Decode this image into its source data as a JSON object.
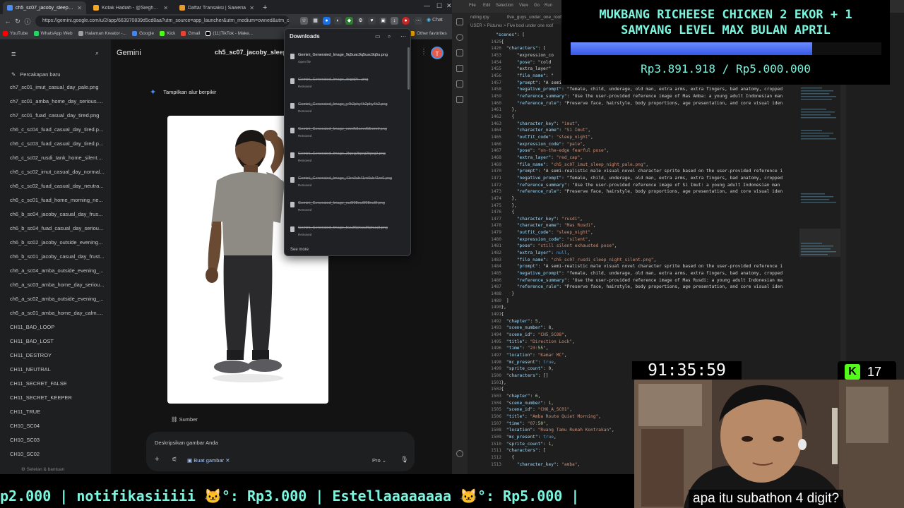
{
  "browser": {
    "tabs": [
      {
        "label": "ch5_sc07_jacoby_sleep_night_frustrat...",
        "active": true,
        "color": "#4c8df6"
      },
      {
        "label": "Kotak Hadiah - @Sieghart | Tako",
        "active": false,
        "color": "#f5a623"
      },
      {
        "label": "Daftar Transaksi | Saweria",
        "active": false,
        "color": "#f5a623"
      }
    ],
    "url": "https://gemini.google.com/u/2/app/663970839d5cd8aa?utm_source=app_launcher&utm_medium=owned&utm_ca...",
    "bookmarks": [
      "YouTube",
      "WhatsApp Web",
      "Halaman Kreator -...",
      "Google",
      "Kick",
      "Gmail",
      "(11)TikTok - Make...",
      "Other favorites"
    ],
    "chat_label": "Chat"
  },
  "gemini": {
    "brand": "Gemini",
    "title": "ch5_sc07_jacoby_sleep_n...",
    "avatar_letter": "T",
    "new_chat": "Percakapan baru",
    "sidebar_items": [
      "ch7_sc01_imut_casual_day_pale.png",
      "ch7_sc01_amba_home_day_serious.p...",
      "ch7_sc01_fuad_casual_day_tired.png",
      "ch6_c_sc04_fuad_casual_day_tired.p...",
      "ch6_c_sc03_fuad_casual_day_tired.p...",
      "ch6_c_sc02_rusdi_tank_home_silent....",
      "ch6_c_sc02_imut_casual_day_normal...",
      "ch6_c_sc02_fuad_casual_day_neutra...",
      "ch6_c_sc01_fuad_home_morning_ne...",
      "ch6_b_sc04_jacoby_casual_day_frus...",
      "ch6_b_sc04_fuad_casual_day_seriou...",
      "ch6_b_sc02_jacoby_outside_evening...",
      "ch6_b_sc01_jacoby_casual_day_frust...",
      "ch6_a_sc04_amba_outside_evening_...",
      "ch6_a_sc03_amba_home_day_seriou...",
      "ch6_a_sc02_amba_outside_evening_...",
      "ch6_a_sc01_amba_home_day_calm.p...",
      "CH11_BAD_LOOP",
      "CH11_BAD_LOST",
      "CH11_DESTROY",
      "CH11_NEUTRAL",
      "CH11_SECRET_FALSE",
      "CH11_SECRET_KEEPER",
      "CH11_TRUE",
      "CH10_SC04",
      "CH10_SC03",
      "CH10_SC02"
    ],
    "settings": "Setelan & bantuan",
    "thinking": "Tampilkan alur berpikir",
    "source": "Sumber",
    "prompt_placeholder": "Deskripsikan gambar Anda",
    "create_image": "Buat gambar",
    "model": "Pro"
  },
  "downloads": {
    "title": "Downloads",
    "items": [
      {
        "name": "Gemini_Generated_Image_9q5uac9q5uac9q5u.png",
        "status": "Open file",
        "removed": false
      },
      {
        "name": "Gemini_Generated_Image_dsgq9k...png",
        "status": "Removed",
        "removed": true
      },
      {
        "name": "Gemini_Generated_Image_y4h2phy4h2phy4h2.png",
        "status": "Removed",
        "removed": true
      },
      {
        "name": "Gemini_Generated_Image_xmnfk5xmnfk5xmnf.png",
        "status": "Removed",
        "removed": true
      },
      {
        "name": "Gemini_Generated_Image_2bprg2bprg2bprg2.png",
        "status": "Removed",
        "removed": true
      },
      {
        "name": "Gemini_Generated_Image_41rn0ub41rn0ub41rn0.png",
        "status": "Removed",
        "removed": true
      },
      {
        "name": "Gemini_Generated_Image_nu6f08nu6f08nu6f.png",
        "status": "Removed",
        "removed": true
      },
      {
        "name": "Gemini_Generated_Image_buu36pkuu36pkuu3.png",
        "status": "Removed",
        "removed": true
      }
    ],
    "see_more": "See more"
  },
  "editor": {
    "menus": [
      "File",
      "Edit",
      "Selection",
      "View",
      "Go",
      "Run"
    ],
    "tabs": [
      "nding.rpy",
      "five_guys_under_one_roof"
    ],
    "breadcrumb": "USER > Pictures > Five bool under one roof",
    "lines": [
      {
        "n": "",
        "t": "\"scenes\": ["
      },
      {
        "n": "1425",
        "t": "  {"
      },
      {
        "n": "1426",
        "t": "    \"characters\": ["
      },
      {
        "n": "1453",
        "t": "        \"expression_co"
      },
      {
        "n": "1454",
        "t": "        \"pose\": \"cold"
      },
      {
        "n": "1455",
        "t": "        \"extra_layer\""
      },
      {
        "n": "1456",
        "t": "        \"file_name\": \""
      },
      {
        "n": "1457",
        "t": "        \"prompt\": \"A semi-realistic male visual novel character sprite based on the user-provided reference i"
      },
      {
        "n": "1458",
        "t": "        \"negative_prompt\": \"female, child, underage, old man, extra arms, extra fingers, bad anatomy, cropped"
      },
      {
        "n": "1459",
        "t": "        \"reference_summary\": \"Use the user-provided reference image of Mas Amba: a young adult Indonesian man"
      },
      {
        "n": "1460",
        "t": "        \"reference_rule\": \"Preserve face, hairstyle, body proportions, age presentation, and core visual iden"
      },
      {
        "n": "1461",
        "t": "      },"
      },
      {
        "n": "1462",
        "t": "      {"
      },
      {
        "n": "1463",
        "t": "        \"character_key\": \"imut\","
      },
      {
        "n": "1464",
        "t": "        \"character_name\": \"Si Imut\","
      },
      {
        "n": "1465",
        "t": "        \"outfit_code\": \"sleep_night\","
      },
      {
        "n": "1466",
        "t": "        \"expression_code\": \"pale\","
      },
      {
        "n": "1467",
        "t": "        \"pose\": \"on-the-edge fearful pose\","
      },
      {
        "n": "1468",
        "t": "        \"extra_layer\": \"red_cap\","
      },
      {
        "n": "1469",
        "t": "        \"file_name\": \"ch5_sc07_imut_sleep_night_pale.png\","
      },
      {
        "n": "1470",
        "t": "        \"prompt\": \"A semi-realistic male visual novel character sprite based on the user-provided reference i"
      },
      {
        "n": "1471",
        "t": "        \"negative_prompt\": \"female, child, underage, old man, extra arms, extra fingers, bad anatomy, cropped"
      },
      {
        "n": "1472",
        "t": "        \"reference_summary\": \"Use the user-provided reference image of Si Imut: a young adult Indonesian man"
      },
      {
        "n": "1473",
        "t": "        \"reference_rule\": \"Preserve face, hairstyle, body proportions, age presentation, and core visual iden"
      },
      {
        "n": "1474",
        "t": "      },"
      },
      {
        "n": "1475",
        "t": "      },"
      },
      {
        "n": "1476",
        "t": "      {"
      },
      {
        "n": "1477",
        "t": "        \"character_key\": \"rusdi\","
      },
      {
        "n": "1478",
        "t": "        \"character_name\": \"Mas Rusdi\","
      },
      {
        "n": "1479",
        "t": "        \"outfit_code\": \"sleep_night\","
      },
      {
        "n": "1480",
        "t": "        \"expression_code\": \"silent\","
      },
      {
        "n": "1481",
        "t": "        \"pose\": \"still silent exhausted pose\","
      },
      {
        "n": "1482",
        "t": "        \"extra_layer\": null,"
      },
      {
        "n": "1483",
        "t": "        \"file_name\": \"ch5_sc07_rusdi_sleep_night_silent.png\","
      },
      {
        "n": "1484",
        "t": "        \"prompt\": \"A semi-realistic male visual novel character sprite based on the user-provided reference i"
      },
      {
        "n": "1485",
        "t": "        \"negative_prompt\": \"female, child, underage, old man, extra arms, extra fingers, bad anatomy, cropped"
      },
      {
        "n": "1486",
        "t": "        \"reference_summary\": \"Use the user-provided reference image of Mas Rusdi: a young adult Indonesian ma"
      },
      {
        "n": "1487",
        "t": "        \"reference_rule\": \"Preserve face, hairstyle, body proportions, age presentation, and core visual iden"
      },
      {
        "n": "1488",
        "t": "      }"
      },
      {
        "n": "1489",
        "t": "    ]"
      },
      {
        "n": "1490",
        "t": "  },"
      },
      {
        "n": "1491",
        "t": "  {"
      },
      {
        "n": "1492",
        "t": "    \"chapter\": 5,"
      },
      {
        "n": "1493",
        "t": "    \"scene_number\": 8,"
      },
      {
        "n": "1494",
        "t": "    \"scene_id\": \"CH5_SC08\","
      },
      {
        "n": "1495",
        "t": "    \"title\": \"Direction Lock\","
      },
      {
        "n": "1496",
        "t": "    \"time\": \"23:55\","
      },
      {
        "n": "1497",
        "t": "    \"location\": \"Kamar MC\","
      },
      {
        "n": "1498",
        "t": "    \"mc_present\": true,"
      },
      {
        "n": "1499",
        "t": "    \"sprite_count\": 0,"
      },
      {
        "n": "1500",
        "t": "    \"characters\": []"
      },
      {
        "n": "1501",
        "t": "  },"
      },
      {
        "n": "1502",
        "t": "  {"
      },
      {
        "n": "1503",
        "t": "    \"chapter\": 6,"
      },
      {
        "n": "1504",
        "t": "    \"scene_number\": 1,"
      },
      {
        "n": "1505",
        "t": "    \"scene_id\": \"CH6_A_SC01\","
      },
      {
        "n": "1506",
        "t": "    \"title\": \"Amba Route Quiet Morning\","
      },
      {
        "n": "1507",
        "t": "    \"time\": \"07:50\","
      },
      {
        "n": "1508",
        "t": "    \"location\": \"Ruang Tamu Rumah Kontrakan\","
      },
      {
        "n": "1509",
        "t": "    \"mc_present\": true,"
      },
      {
        "n": "1510",
        "t": "    \"sprite_count\": 1,"
      },
      {
        "n": "1511",
        "t": "    \"characters\": ["
      },
      {
        "n": "1512",
        "t": "      {"
      },
      {
        "n": "1513",
        "t": "        \"character_key\": \"amba\","
      }
    ]
  },
  "overlay": {
    "goal_title_1": "MUKBANG RICHEESE CHICKEN 2 EKOR + 1",
    "goal_title_2": "SAMYANG LEVEL MAX BULAN APRIL",
    "goal_current": "Rp3.891.918",
    "goal_target": "Rp5.000.000",
    "goal_amount_text": "Rp3.891.918 / Rp5.000.000",
    "goal_progress": 0.778,
    "goal_color": "#7cf5df",
    "timer": "91:35:59",
    "kick_count": "17",
    "kick_color": "#53fc18",
    "ticker": "p2.000 | notifikasiiiii 🐱°: Rp3.000 | Estellaaaaaaaa 🐱°: Rp5.000 | ",
    "chat_message": "apa itu subathon 4 digit?"
  }
}
